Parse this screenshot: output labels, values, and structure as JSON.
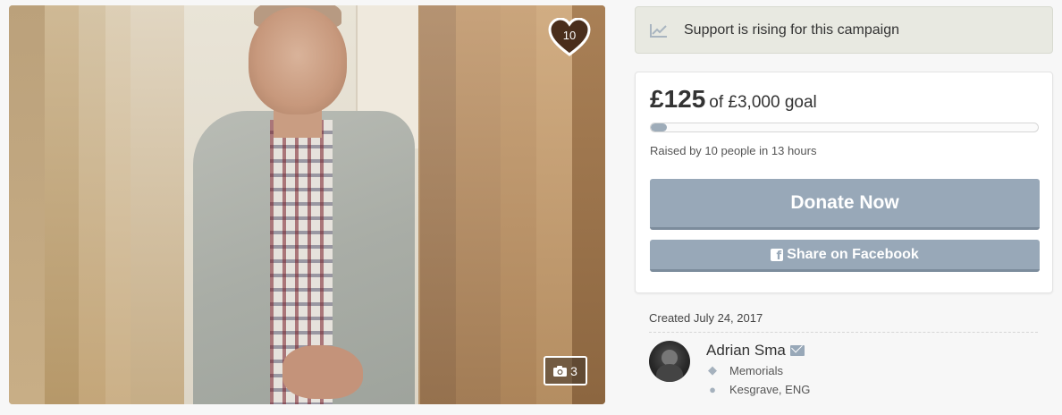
{
  "photo": {
    "alt": "Campaign photo",
    "hearts": "10",
    "photo_count": "3"
  },
  "rising": {
    "icon": "trending-chart-icon",
    "text": "Support is rising for this campaign"
  },
  "donation": {
    "raised": "£125",
    "goal": "of £3,000 goal",
    "progress_fraction": 0.042,
    "raised_by": "Raised by 10 people in 13 hours",
    "donate_label": "Donate Now",
    "share_label": "Share on Facebook"
  },
  "meta": {
    "created": "Created July 24, 2017"
  },
  "organizer": {
    "name": "Adrian Sma",
    "category": "Memorials",
    "location": "Kesgrave, ENG"
  },
  "colors": {
    "button": "#98a8b8",
    "rising_bg": "#e8e9e1",
    "progress_fill": "#9eacb9"
  }
}
